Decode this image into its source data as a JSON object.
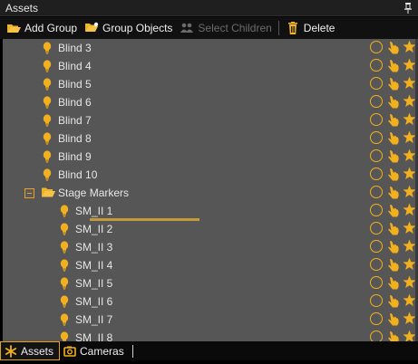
{
  "panel": {
    "title": "Assets"
  },
  "toolbar": {
    "add_group": "Add Group",
    "group_objects": "Group Objects",
    "select_children": "Select Children",
    "delete": "Delete"
  },
  "tree": {
    "items": [
      {
        "label": "Blind 3",
        "kind": "fixture",
        "depth": 1
      },
      {
        "label": "Blind 4",
        "kind": "fixture",
        "depth": 1
      },
      {
        "label": "Blind 5",
        "kind": "fixture",
        "depth": 1
      },
      {
        "label": "Blind 6",
        "kind": "fixture",
        "depth": 1
      },
      {
        "label": "Blind 7",
        "kind": "fixture",
        "depth": 1
      },
      {
        "label": "Blind 8",
        "kind": "fixture",
        "depth": 1
      },
      {
        "label": "Blind 9",
        "kind": "fixture",
        "depth": 1
      },
      {
        "label": "Blind 10",
        "kind": "fixture",
        "depth": 1
      },
      {
        "label": "Stage Markers",
        "kind": "group",
        "depth": 1,
        "expanded": true
      },
      {
        "label": "SM_II 1",
        "kind": "fixture",
        "depth": 2
      },
      {
        "label": "SM_II 2",
        "kind": "fixture",
        "depth": 2
      },
      {
        "label": "SM_II 3",
        "kind": "fixture",
        "depth": 2
      },
      {
        "label": "SM_II 4",
        "kind": "fixture",
        "depth": 2
      },
      {
        "label": "SM_II 5",
        "kind": "fixture",
        "depth": 2
      },
      {
        "label": "SM_II 6",
        "kind": "fixture",
        "depth": 2
      },
      {
        "label": "SM_II 7",
        "kind": "fixture",
        "depth": 2
      },
      {
        "label": "SM_II 8",
        "kind": "fixture",
        "depth": 2
      }
    ]
  },
  "tabs": [
    {
      "label": "Assets",
      "icon": "asterisk-icon",
      "active": true
    },
    {
      "label": "Cameras",
      "icon": "camera-icon",
      "active": false
    }
  ],
  "colors": {
    "accent": "#f2b01e",
    "tree_bg": "#565656",
    "panel_bg": "#000000"
  }
}
